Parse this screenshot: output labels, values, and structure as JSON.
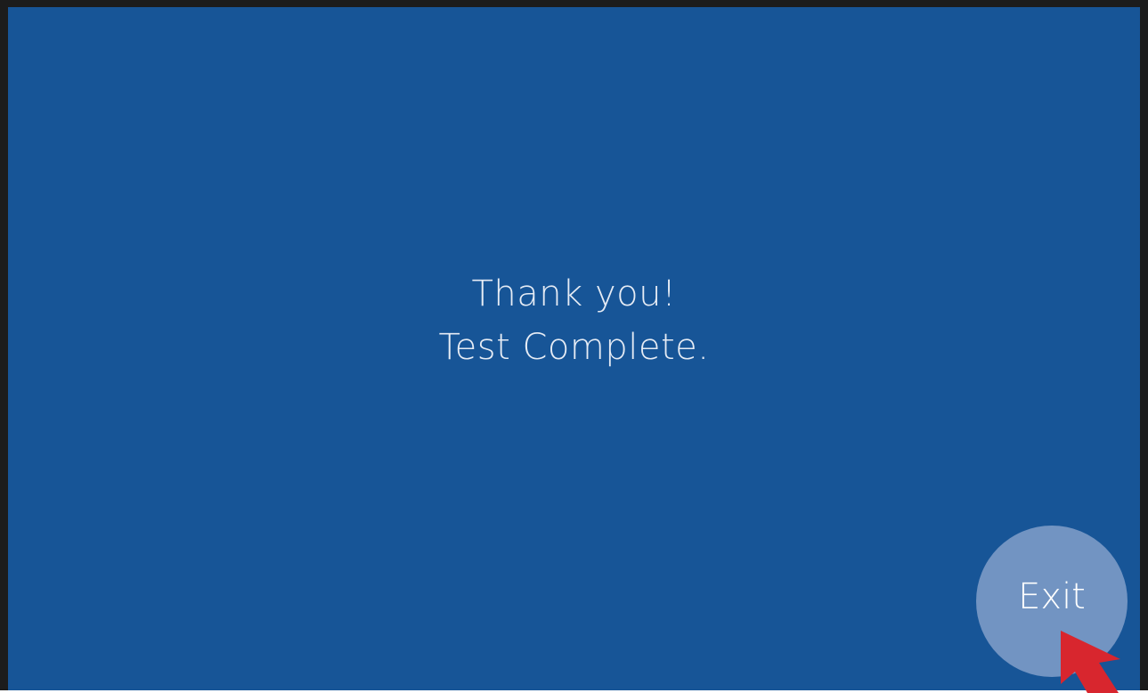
{
  "message": {
    "line1": "Thank you!",
    "line2": "Test Complete."
  },
  "exit_button": {
    "label": "Exit"
  },
  "colors": {
    "background": "#175597",
    "frame": "#1c1c1c",
    "button": "#7294c2",
    "text": "#e6ecf5",
    "cursor": "#d8262e"
  },
  "icons": {
    "cursor": "red-arrow-cursor-icon"
  }
}
